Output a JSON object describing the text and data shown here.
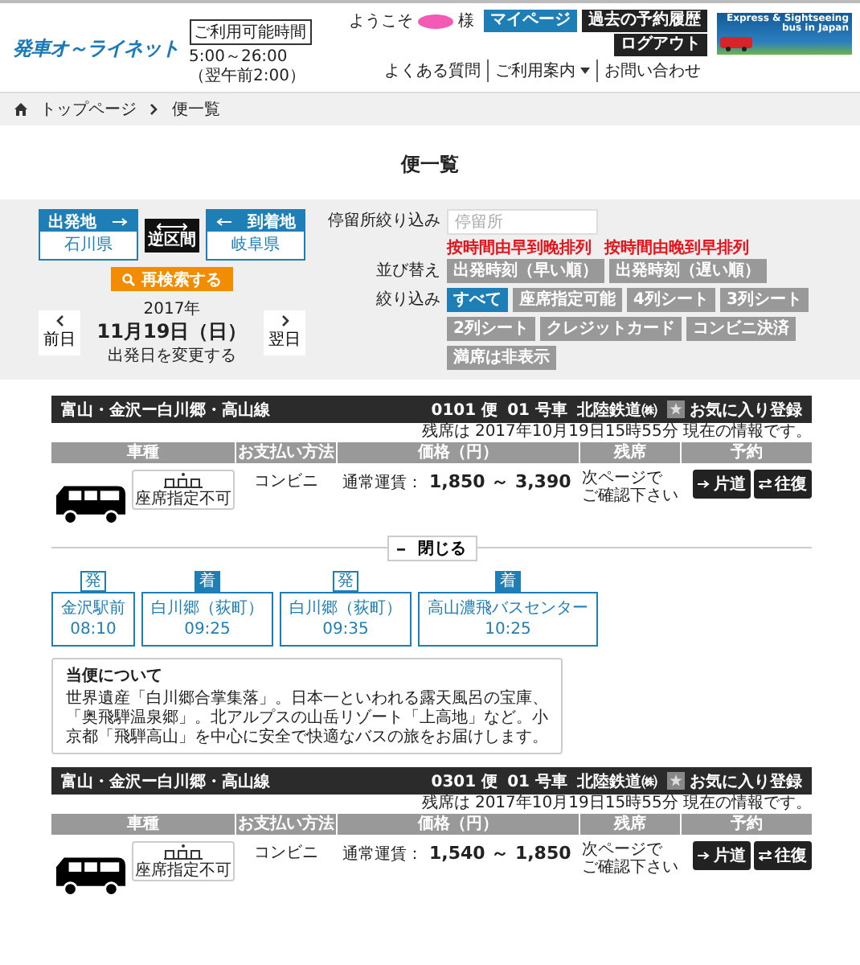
{
  "header": {
    "logo": "発車オ～ライネット",
    "hours_label": "ご利用可能時間",
    "hours": "5:00～26:00（翌午前2:00）",
    "welcome": "ようこそ",
    "honorific": "様",
    "buttons": [
      {
        "label": "マイページ",
        "kind": "primary"
      },
      {
        "label": "過去の予約履歴",
        "kind": "dark"
      },
      {
        "label": "ログアウト",
        "kind": "dark"
      }
    ],
    "links": [
      {
        "label": "よくある質問",
        "dropdown": false
      },
      {
        "label": "ご利用案内",
        "dropdown": true
      },
      {
        "label": "お問い合わせ",
        "dropdown": false
      }
    ],
    "banner": {
      "line1": "Express & Sightseeing",
      "line2": "bus in Japan"
    }
  },
  "breadcrumb": [
    "トップページ",
    "便一覧"
  ],
  "page_title": "便一覧",
  "search": {
    "from": {
      "label": "出発地",
      "value": "石川県"
    },
    "swap": "逆区間",
    "to": {
      "label": "到着地",
      "value": "岐阜県"
    },
    "research": "再検索する",
    "prev": "前日",
    "next": "翌日",
    "year": "2017年",
    "date": "11月19日（日）",
    "change_date": "出発日を変更する",
    "stop_label": "停留所絞り込み",
    "stop_placeholder": "停留所",
    "annotations": [
      "按時間由早到晚排列",
      "按時間由晚到早排列"
    ],
    "sort_label": "並び替え",
    "sort": [
      {
        "label": "出発時刻（早い順）",
        "selected": false
      },
      {
        "label": "出発時刻（遅い順）",
        "selected": false
      }
    ],
    "filter_label": "絞り込み",
    "filters": [
      {
        "label": "すべて",
        "selected": true
      },
      {
        "label": "座席指定可能",
        "selected": false
      },
      {
        "label": "4列シート",
        "selected": false
      },
      {
        "label": "3列シート",
        "selected": false
      },
      {
        "label": "2列シート",
        "selected": false
      },
      {
        "label": "クレジットカード",
        "selected": false
      },
      {
        "label": "コンビニ決済",
        "selected": false
      },
      {
        "label": "満席は非表示",
        "selected": false
      }
    ]
  },
  "buses": [
    {
      "route": "富山・金沢ー白川郷・高山線",
      "bin": "0101 便",
      "car": "01 号車",
      "operator": "北陸鉄道㈱",
      "favorite": "お気に入り登録",
      "updated": "残席は 2017年10月19日15時55分 現在の情報です。",
      "columns": [
        "車種",
        "お支払い方法",
        "価格（円）",
        "残席",
        "予約"
      ],
      "seat_badge": "座席指定不可",
      "payment": "コンビニ",
      "fare_label": "通常運賃：",
      "price": "1,850 ～ 3,390",
      "seats": [
        "次ページで",
        "ご確認下さい"
      ],
      "one_way": "片道",
      "round_trip": "往復",
      "detail": {
        "toggle": "閉じる",
        "expanded": true,
        "stops": [
          {
            "kind": "dep",
            "badge": "発",
            "name": "金沢駅前",
            "time": "08:10"
          },
          {
            "kind": "arr",
            "badge": "着",
            "name": "白川郷（荻町）",
            "time": "09:25"
          },
          {
            "kind": "dep",
            "badge": "発",
            "name": "白川郷（荻町）",
            "time": "09:35"
          },
          {
            "kind": "arr",
            "badge": "着",
            "name": "高山濃飛バスセンター",
            "time": "10:25"
          }
        ],
        "about_title": "当便について",
        "about": "世界遺産「白川郷合掌集落」。日本一といわれる露天風呂の宝庫、「奥飛騨温泉郷」。北アルプスの山岳リゾート「上高地」など。小京都「飛騨高山」を中心に安全で快適なバスの旅をお届けします。"
      }
    },
    {
      "route": "富山・金沢ー白川郷・高山線",
      "bin": "0301 便",
      "car": "01 号車",
      "operator": "北陸鉄道㈱",
      "favorite": "お気に入り登録",
      "updated": "残席は 2017年10月19日15時55分 現在の情報です。",
      "columns": [
        "車種",
        "お支払い方法",
        "価格（円）",
        "残席",
        "予約"
      ],
      "seat_badge": "座席指定不可",
      "payment": "コンビニ",
      "fare_label": "通常運賃：",
      "price": "1,540 ～ 1,850",
      "seats": [
        "次ページで",
        "ご確認下さい"
      ],
      "one_way": "片道",
      "round_trip": "往復"
    }
  ]
}
